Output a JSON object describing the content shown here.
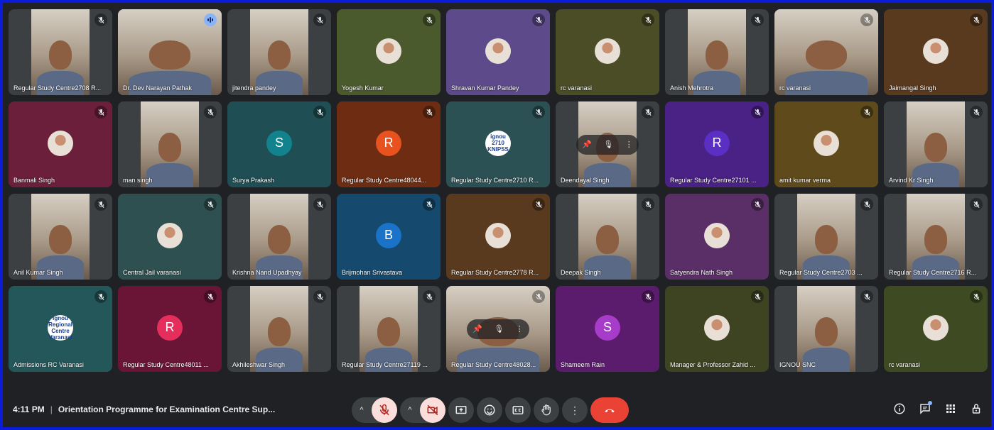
{
  "meeting": {
    "time": "4:11 PM",
    "title": "Orientation Programme for Examination Centre Sup..."
  },
  "colors": {
    "background": "#202124",
    "frame": "#0a1cd8",
    "end_call": "#ea4335",
    "off_button": "#f9dedc",
    "active_outline": "#8ab4f8"
  },
  "participants": [
    {
      "name": "Regular Study Centre2708 R...",
      "kind": "video",
      "bg": "#3c4043",
      "mic": "muted"
    },
    {
      "name": "Dr. Dev Narayan Pathak",
      "kind": "video",
      "bg": "#3c4043",
      "mic": "speaking",
      "active": true,
      "wide": true
    },
    {
      "name": "jitendra pandey",
      "kind": "video",
      "bg": "#3c4043",
      "mic": "muted"
    },
    {
      "name": "Yogesh Kumar",
      "kind": "photo",
      "bg": "#4a5a2c",
      "mic": "muted"
    },
    {
      "name": "Shravan Kumar Pandey",
      "kind": "photo",
      "bg": "#5d4a8a",
      "mic": "muted"
    },
    {
      "name": "rc varanasi",
      "kind": "photo",
      "bg": "#4a4d26",
      "mic": "muted"
    },
    {
      "name": "Anish Mehrotra",
      "kind": "video",
      "bg": "#3c4043",
      "mic": "muted"
    },
    {
      "name": "rc varanasi",
      "kind": "video",
      "bg": "#3c4043",
      "mic": "muted",
      "wide": true
    },
    {
      "name": "Jaimangal Singh",
      "kind": "photo",
      "bg": "#5a3a1e",
      "mic": "muted"
    },
    {
      "name": "Banmali Singh",
      "kind": "photo",
      "bg": "#6b1f3a",
      "mic": "muted"
    },
    {
      "name": "man singh",
      "kind": "video",
      "bg": "#3c4043",
      "mic": "muted"
    },
    {
      "name": "Surya Prakash",
      "kind": "letter",
      "letter": "S",
      "avatar_color": "#12838e",
      "bg": "#1f4f54",
      "mic": "muted"
    },
    {
      "name": "Regular Study Centre48044...",
      "kind": "letter",
      "letter": "R",
      "avatar_color": "#e8521f",
      "bg": "#6e2d12",
      "mic": "muted"
    },
    {
      "name": "Regular Study Centre2710 R...",
      "kind": "logo",
      "logo_text": "ignou 2710 KNIPSS",
      "bg": "#2c5154",
      "mic": "muted"
    },
    {
      "name": "Deendayal Singh",
      "kind": "video",
      "bg": "#3c4043",
      "mic": "muted",
      "hover": true
    },
    {
      "name": "Regular Study Centre27101 ...",
      "kind": "letter",
      "letter": "R",
      "avatar_color": "#5b2fc4",
      "bg": "#4a2185",
      "mic": "muted"
    },
    {
      "name": "amit kumar verma",
      "kind": "photo",
      "bg": "#5e4a1a",
      "mic": "muted"
    },
    {
      "name": "Arvind Kr Singh",
      "kind": "video",
      "bg": "#3c4043",
      "mic": "muted"
    },
    {
      "name": "Anil Kumar Singh",
      "kind": "video",
      "bg": "#3c4043",
      "mic": "muted"
    },
    {
      "name": "Central Jail varanasi",
      "kind": "photo",
      "bg": "#2e5050",
      "mic": "muted"
    },
    {
      "name": "Krishna Nand Upadhyay",
      "kind": "video",
      "bg": "#3c4043",
      "mic": "muted"
    },
    {
      "name": "Brijmohan Srivastava",
      "kind": "letter",
      "letter": "B",
      "avatar_color": "#1a73c8",
      "bg": "#154a6e",
      "mic": "muted"
    },
    {
      "name": "Regular Study Centre2778 R...",
      "kind": "photo",
      "bg": "#5a3a1e",
      "mic": "muted"
    },
    {
      "name": "Deepak Singh",
      "kind": "video",
      "bg": "#3c4043",
      "mic": "muted"
    },
    {
      "name": "Satyendra Nath Singh",
      "kind": "photo",
      "bg": "#5a2e66",
      "mic": "muted"
    },
    {
      "name": "Regular Study Centre2703 ...",
      "kind": "video",
      "bg": "#3c4043",
      "mic": "muted"
    },
    {
      "name": "Regular Study Centre2716 R...",
      "kind": "video",
      "bg": "#3c4043",
      "mic": "muted"
    },
    {
      "name": "Admissions RC Varanasi",
      "kind": "logo",
      "logo_text": "ignou Regional Centre Varanasi",
      "bg": "#24575a",
      "mic": "muted"
    },
    {
      "name": "Regular Study Centre48011 ...",
      "kind": "letter",
      "letter": "R",
      "avatar_color": "#e62e5c",
      "bg": "#6b1536",
      "mic": "muted"
    },
    {
      "name": "Akhileshwar Singh",
      "kind": "video",
      "bg": "#3c4043",
      "mic": "muted"
    },
    {
      "name": "Regular Study Centre27119 ...",
      "kind": "video",
      "bg": "#3c4043",
      "mic": "muted"
    },
    {
      "name": "Regular Study Centre48028...",
      "kind": "video",
      "bg": "#3c4043",
      "mic": "muted",
      "hover": true,
      "wide": true
    },
    {
      "name": "Shameem Rain",
      "kind": "letter",
      "letter": "S",
      "avatar_color": "#a63cc9",
      "bg": "#5c1c6e",
      "mic": "muted"
    },
    {
      "name": "Manager & Professor Zahid ...",
      "kind": "photo",
      "bg": "#3e4422",
      "mic": "muted"
    },
    {
      "name": "IGNOU SNC",
      "kind": "video",
      "bg": "#3c4043",
      "mic": "muted"
    },
    {
      "name": "rc varanasi",
      "kind": "photo",
      "bg": "#3e4a22",
      "mic": "muted"
    }
  ],
  "controls": {
    "mic_chevron": "^",
    "cam_chevron": "^",
    "more_label": "⋮"
  },
  "icons": {
    "info": "info-icon",
    "chat": "chat-icon",
    "activities": "activities-icon",
    "host": "host-controls-icon"
  }
}
